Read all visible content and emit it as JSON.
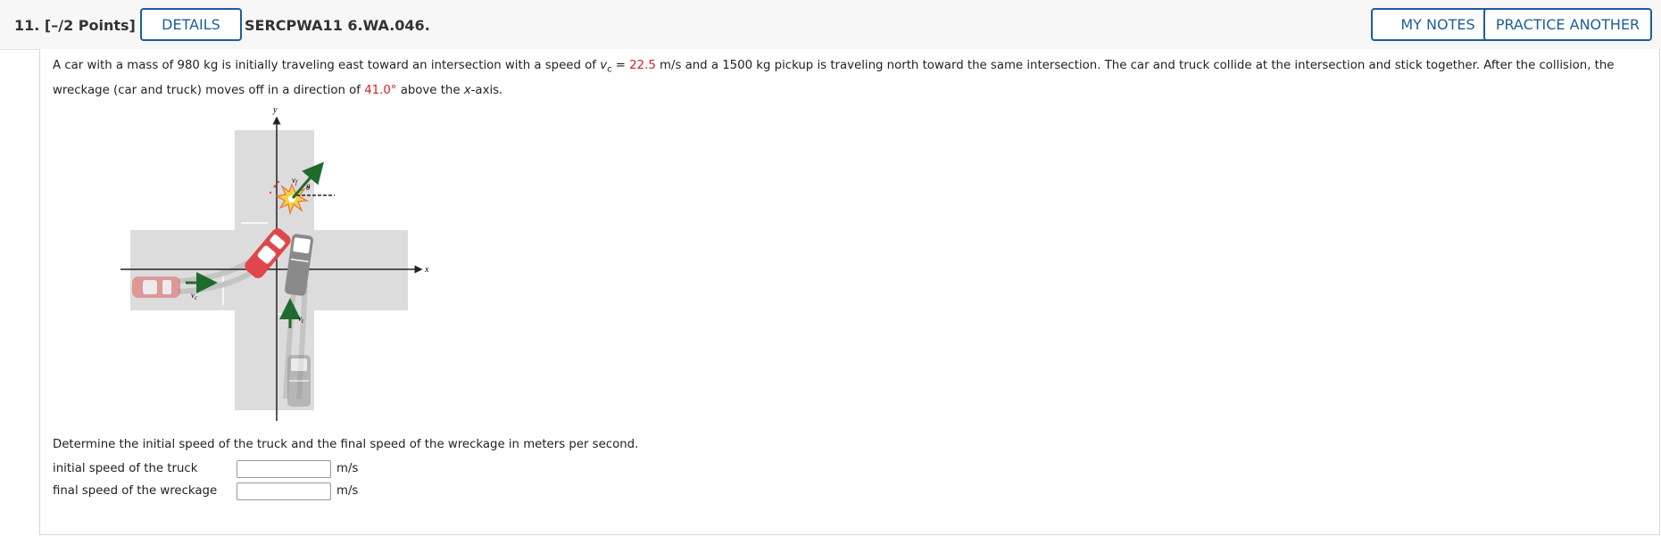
{
  "header": {
    "question_number": "11.",
    "points": "[–/2 Points]",
    "details_label": "DETAILS",
    "assignment_id": "SERCPWA11 6.WA.046.",
    "my_notes_label": "MY NOTES",
    "practice_label": "PRACTICE ANOTHER"
  },
  "problem": {
    "part1": "A car with a mass of 980 kg is initially traveling east toward an intersection with a speed of ",
    "var_v": "v",
    "var_sub": "c",
    "eq": " = ",
    "speed_value": "22.5",
    "part2": " m/s and a 1500 kg pickup is traveling north toward the same intersection. The car and truck collide at the intersection and stick together. After the collision, the wreckage (car and truck) moves off in a direction of ",
    "angle_value": "41.0°",
    "part3": " above the ",
    "x_axis": "x",
    "part4": "-axis."
  },
  "figure": {
    "y_label": "y",
    "x_label": "x",
    "vf_label": "v",
    "vf_sub": "f",
    "theta_label": "θ",
    "vc_label": "v",
    "vc_sub": "c",
    "vt_label": "v",
    "vt_sub": "t",
    "colors": {
      "road": "#dcdcdc",
      "arrow": "#1f6b2e",
      "car": "#e0474c",
      "truck": "#8a8a8a"
    }
  },
  "question": {
    "text": "Determine the initial speed of the truck and the final speed of the wreckage in meters per second."
  },
  "fields": [
    {
      "label": "initial speed of the truck",
      "value": "",
      "unit": "m/s"
    },
    {
      "label": "final speed of the wreckage",
      "value": "",
      "unit": "m/s"
    }
  ]
}
